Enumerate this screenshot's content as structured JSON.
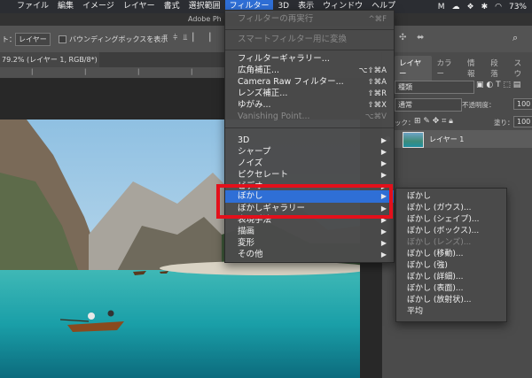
{
  "menubar": {
    "apple_icon": "apple-icon",
    "items": [
      "ファイル",
      "編集",
      "イメージ",
      "レイヤー",
      "書式",
      "選択範囲",
      "フィルター",
      "3D",
      "表示",
      "ウィンドウ",
      "ヘルプ"
    ],
    "active_index": 6,
    "status": {
      "battery": "73%"
    }
  },
  "window": {
    "title": "Adobe Ph"
  },
  "options": {
    "auto_select_label": "ト：",
    "auto_select_value": "レイヤー",
    "bbox_label": "バウンディングボックスを表示"
  },
  "document": {
    "tab_label": "79.2% (レイヤー 1, RGB/8*)"
  },
  "panel": {
    "tabs": [
      "レイヤー",
      "カラー",
      "情報",
      "段落",
      "スウ"
    ],
    "kind_value": "種類",
    "blend_mode": "通常",
    "opacity_label": "不透明度：",
    "opacity_value": "100",
    "lock_label": "ック：",
    "fill_label": "塗り：",
    "fill_value": "100",
    "layer_name": "レイヤー 1"
  },
  "filter_menu": {
    "items": [
      {
        "label": "フィルターの再実行",
        "shortcut": "^⌘F",
        "disabled": true
      },
      {
        "label": "スマートフィルター用に変換",
        "disabled": true
      },
      {
        "label": "フィルターギャラリー..."
      },
      {
        "label": "広角補正...",
        "shortcut": "⌥⇧⌘A"
      },
      {
        "label": "Camera Raw フィルター...",
        "shortcut": "⇧⌘A"
      },
      {
        "label": "レンズ補正...",
        "shortcut": "⇧⌘R"
      },
      {
        "label": "ゆがみ...",
        "shortcut": "⇧⌘X"
      },
      {
        "label": "Vanishing Point...",
        "shortcut": "⌥⌘V",
        "disabled": true
      },
      {
        "label": "3D",
        "submenu": true
      },
      {
        "label": "シャープ",
        "submenu": true
      },
      {
        "label": "ノイズ",
        "submenu": true
      },
      {
        "label": "ピクセレート",
        "submenu": true
      },
      {
        "label": "ビデオ",
        "submenu": true
      },
      {
        "label": "ぼかし",
        "submenu": true,
        "highlighted": true
      },
      {
        "label": "ぼかしギャラリー",
        "submenu": true
      },
      {
        "label": "表現手法",
        "submenu": true
      },
      {
        "label": "描画",
        "submenu": true
      },
      {
        "label": "変形",
        "submenu": true
      },
      {
        "label": "その他",
        "submenu": true
      }
    ]
  },
  "blur_submenu": {
    "items": [
      {
        "label": "ぼかし"
      },
      {
        "label": "ぼかし (ガウス)..."
      },
      {
        "label": "ぼかし (シェイプ)..."
      },
      {
        "label": "ぼかし (ボックス)..."
      },
      {
        "label": "ぼかし (レンズ)...",
        "disabled": true
      },
      {
        "label": "ぼかし (移動)..."
      },
      {
        "label": "ぼかし (強)"
      },
      {
        "label": "ぼかし (詳細)..."
      },
      {
        "label": "ぼかし (表面)..."
      },
      {
        "label": "ぼかし (放射状)..."
      },
      {
        "label": "平均"
      }
    ]
  },
  "colors": {
    "highlight": "#2f6fd6",
    "annotation_box": "#e3101b"
  }
}
